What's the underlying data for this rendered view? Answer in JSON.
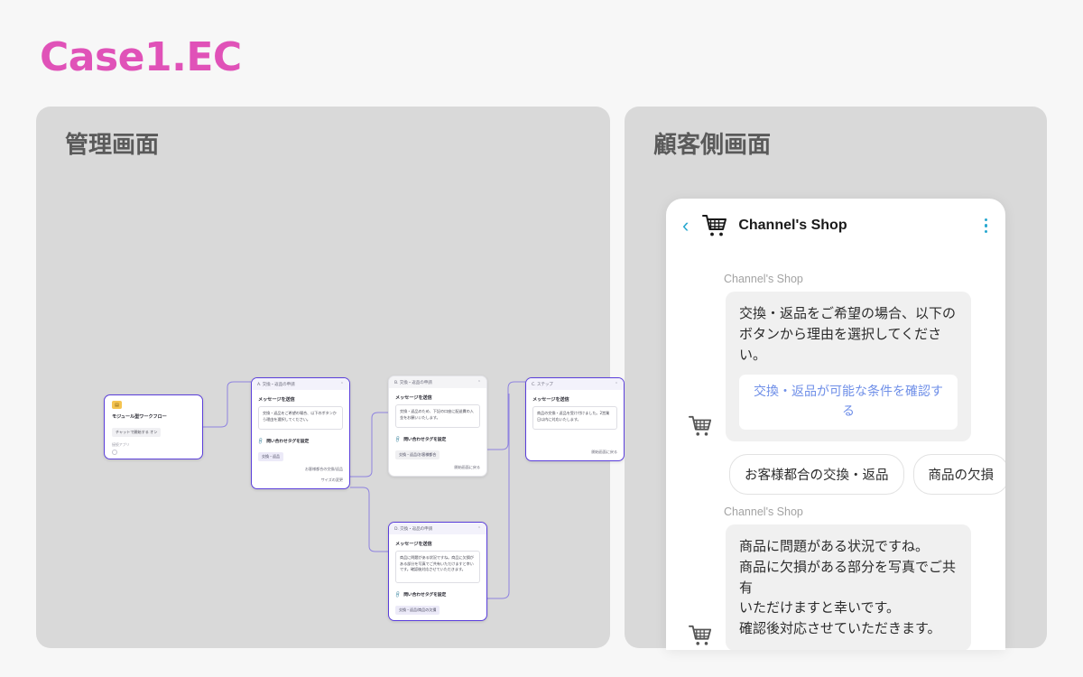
{
  "page": {
    "title": "Case1.EC",
    "accent_color": "#e052b8"
  },
  "panels": {
    "admin": {
      "heading": "管理画面"
    },
    "client": {
      "heading": "顧客側画面"
    }
  },
  "flow": {
    "start_node": {
      "icon": "workflow-icon",
      "title": "モジュール型ワークフロー",
      "chip": "チャットで開始する  オン",
      "sub_label": "接続アプリ"
    },
    "nodes": [
      {
        "id": "node-a",
        "header": "A. 交換・返品の申請",
        "section_label": "メッセージを送信",
        "message": "交換・返品をご希望の場合、以下のボタンから理由を選択してください。",
        "tag_label": "問い合わせタグを設定",
        "tag_chip": "交換・返品",
        "outputs": [
          "お客様都合の交換/返品",
          "サイズの変更"
        ]
      },
      {
        "id": "node-b",
        "header": "B. 交換・返品の申請",
        "section_label": "メッセージを送信",
        "message": "交換・返品のため、下記の口座に配送費の入金をお願いいたします。",
        "tag_label": "問い合わせタグを設定",
        "tag_chip": "交換・返品/お客様都合",
        "outputs": [
          "開始画面に戻る"
        ]
      },
      {
        "id": "node-c",
        "header": "C. ステップ",
        "section_label": "メッセージを送信",
        "message": "商品の交換・返品を受け付けました。2営業日以内に対応いたします。",
        "tag_label": "",
        "tag_chip": "",
        "outputs": [
          "開始画面に戻る"
        ]
      },
      {
        "id": "node-d",
        "header": "D. 交換・返品の申請",
        "section_label": "メッセージを送信",
        "message": "商品に問題がある状況ですね。商品に欠損がある部分を写真でご共有いただけますと幸いです。確認後対応させていただきます。",
        "tag_label": "問い合わせタグを設定",
        "tag_chip": "交換・返品/商品の欠損",
        "outputs": []
      }
    ]
  },
  "phone": {
    "back_icon": "chevron-left-icon",
    "shop_icon": "shopping-cart-icon",
    "shop_name": "Channel's Shop",
    "menu_icon": "kebab-menu-icon",
    "accent_color": "#29a8d0",
    "messages": [
      {
        "sender": "Channel's Shop",
        "text": "交換・返品をご希望の場合、以下のボタンから理由を選択してください。",
        "link": "交換・返品が可能な条件を確認する"
      },
      {
        "sender": "Channel's Shop",
        "text": "商品に問題がある状況ですね。\n商品に欠損がある部分を写真でご共有\nいただけますと幸いです。\n確認後対応させていただきます。"
      }
    ],
    "options": [
      "お客様都合の交換・返品",
      "商品の欠損"
    ]
  }
}
